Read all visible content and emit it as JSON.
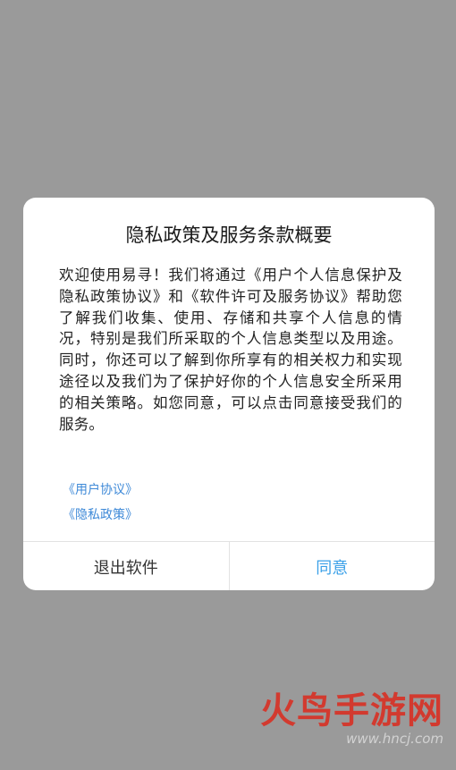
{
  "dialog": {
    "title": "隐私政策及服务条款概要",
    "body": "欢迎使用易寻！我们将通过《用户个人信息保护及隐私政策协议》和《软件许可及服务协议》帮助您了解我们收集、使用、存储和共享个人信息的情况，特别是我们所采取的个人信息类型以及用途。同时，你还可以了解到你所享有的相关权力和实现途径以及我们为了保护好你的个人信息安全所采用的相关策略。如您同意，可以点击同意接受我们的服务。",
    "links": [
      "《用户协议》",
      "《隐私政策》"
    ],
    "exit_label": "退出软件",
    "agree_label": "同意"
  },
  "watermark": {
    "logo": "火鸟手游网",
    "url": "www.hncj.com"
  },
  "colors": {
    "overlay": "#9a9a9a",
    "link": "#3f8ad8",
    "agree": "#3aa0e8",
    "watermark": "#d23a2f"
  }
}
